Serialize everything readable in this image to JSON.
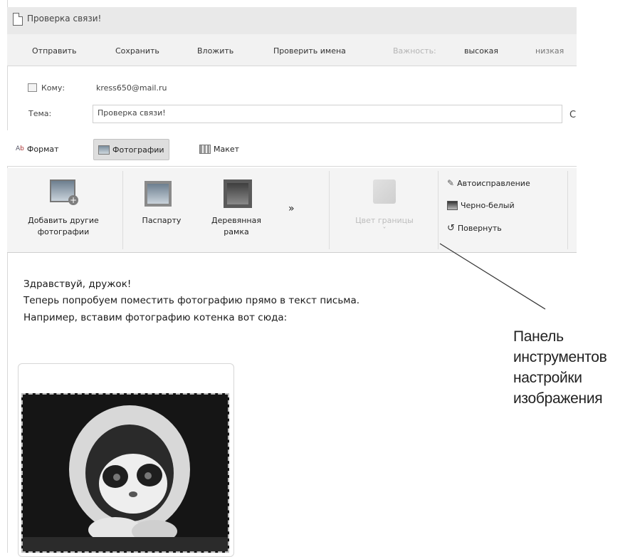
{
  "window": {
    "title": "Проверка связи!"
  },
  "toolbar": {
    "send": "Отправить",
    "save": "Сохранить",
    "attach": "Вложить",
    "check_names": "Проверить имена",
    "importance_label": "Важность:",
    "importance_high": "высокая",
    "importance_low": "низкая"
  },
  "header": {
    "to_label": "Кому:",
    "to_value": "kress650@mail.ru",
    "subject_label": "Тема:",
    "subject_value": "Проверка связи!",
    "cut_letter": "С"
  },
  "subtoolbar": {
    "format": "Формат",
    "photos": "Фотографии",
    "layout": "Макет"
  },
  "ribbon": {
    "add_photos_line1": "Добавить другие",
    "add_photos_line2": "фотографии",
    "passepartout": "Паспарту",
    "wooden_line1": "Деревянная",
    "wooden_line2": "рамка",
    "more": "»",
    "border_color": "Цвет границы",
    "border_dropdown": "ˇ",
    "autocorrect": "Автоисправление",
    "black_white": "Черно-белый",
    "rotate": "Повернуть"
  },
  "body": {
    "line1": "Здравствуй, дружок!",
    "line2": "Теперь попробуем поместить фотографию прямо в текст письма.",
    "line3": "Например, вставим фотографию котенка вот сюда:"
  },
  "callout": {
    "line1": "Панель",
    "line2": "инструментов",
    "line3": "настройки",
    "line4": "изображения"
  },
  "colors": {
    "toolbar_bg": "#f2f2f2",
    "ribbon_bg": "#f4f4f4",
    "active_tab": "#dedede"
  }
}
